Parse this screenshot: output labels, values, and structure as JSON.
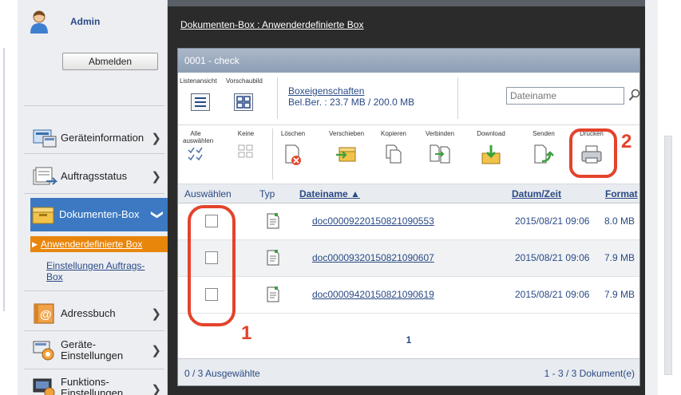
{
  "user": {
    "name": "Admin",
    "logout_label": "Abmelden"
  },
  "sidebar": {
    "items": [
      {
        "label": "Geräteinformation"
      },
      {
        "label": "Auftragsstatus"
      },
      {
        "label": "Dokumenten-Box"
      },
      {
        "label": "Adressbuch"
      },
      {
        "label": "Geräte-\nEinstellungen"
      },
      {
        "label": "Funktions-\nEinstellungen"
      }
    ],
    "sub_items": [
      {
        "label": "Anwenderdefinierte Box"
      },
      {
        "label": "Einstellungen Auftrags-Box"
      }
    ]
  },
  "breadcrumb": "Dokumenten-Box : Anwenderdefinierte Box",
  "panel": {
    "title": "0001 - check",
    "views": {
      "list": "Listenansicht",
      "thumb": "Vorschaubild"
    },
    "box_properties": "Boxeigenschaften",
    "box_usage": "Bel.Ber. : 23.7 MB / 200.0 MB",
    "search_placeholder": "Dateiname"
  },
  "toolbar": {
    "select_all": "Alle auswählen",
    "none": "Keine",
    "delete": "Löschen",
    "move": "Verschieben",
    "copy": "Kopieren",
    "merge": "Verbinden",
    "download": "Download",
    "send": "Senden",
    "print": "Drucken"
  },
  "table": {
    "headers": {
      "select": "Auswählen",
      "type": "Typ",
      "filename": "Dateiname ▲",
      "datetime": "Datum/Zeit",
      "format": "Format"
    },
    "rows": [
      {
        "name": "doc00009220150821090553",
        "date": "2015/08/21 09:06",
        "size": "8.0 MB"
      },
      {
        "name": "doc00009320150821090607",
        "date": "2015/08/21 09:06",
        "size": "7.9 MB"
      },
      {
        "name": "doc00009420150821090619",
        "date": "2015/08/21 09:06",
        "size": "7.9 MB"
      }
    ]
  },
  "pager": {
    "page": "1"
  },
  "footer": {
    "selected": "0 / 3 Ausgewählte",
    "range": "1 - 3 / 3 Dokument(e)"
  },
  "callouts": {
    "one": "1",
    "two": "2"
  },
  "colors": {
    "accent_blue": "#3c79c2",
    "accent_orange": "#e8860b",
    "callout_red": "#e4432c",
    "link_blue": "#2a4a86"
  }
}
